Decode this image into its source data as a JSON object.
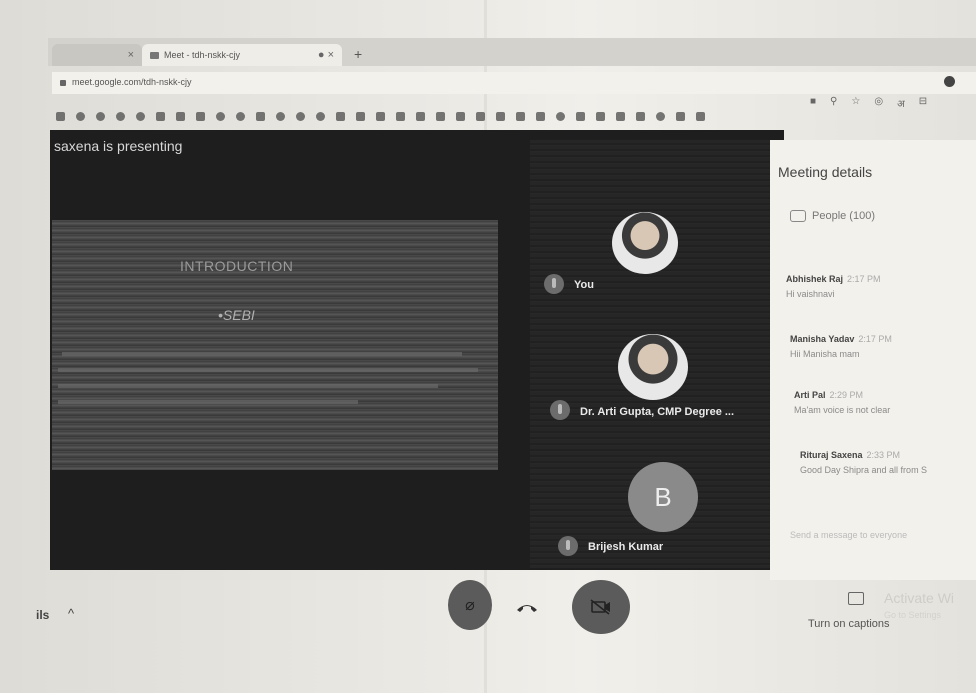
{
  "browser": {
    "tabs": [
      {
        "label": ""
      },
      {
        "label": "Meet - tdh-nskk-cjy"
      }
    ],
    "url": "meet.google.com/tdh-nskk-cjy"
  },
  "presentation": {
    "presenting_label": "saxena is presenting",
    "slide_title": "INTRODUCTION",
    "slide_subtitle": "•SEBI"
  },
  "participants": [
    {
      "name": "You"
    },
    {
      "name": "Dr. Arti Gupta, CMP Degree ..."
    },
    {
      "name": "Brijesh Kumar",
      "initial": "B"
    }
  ],
  "panel": {
    "title": "Meeting details",
    "people_label": "People (100)",
    "messages": [
      {
        "sender": "Abhishek Raj",
        "time": "2:17 PM",
        "text": "Hi vaishnavi"
      },
      {
        "sender": "Manisha Yadav",
        "time": "2:17 PM",
        "text": "Hii Manisha  mam"
      },
      {
        "sender": "Arti Pal",
        "time": "2:29 PM",
        "text": "Ma'am voice is not clear"
      },
      {
        "sender": "Rituraj Saxena",
        "time": "2:33 PM",
        "text": "Good Day Shipra and all from S"
      }
    ],
    "send_placeholder": "Send a message to everyone"
  },
  "bottom": {
    "details_label": "ils",
    "captions_label": "Turn on captions",
    "activate_title": "Activate Wi",
    "activate_sub": "Go to Settings"
  }
}
